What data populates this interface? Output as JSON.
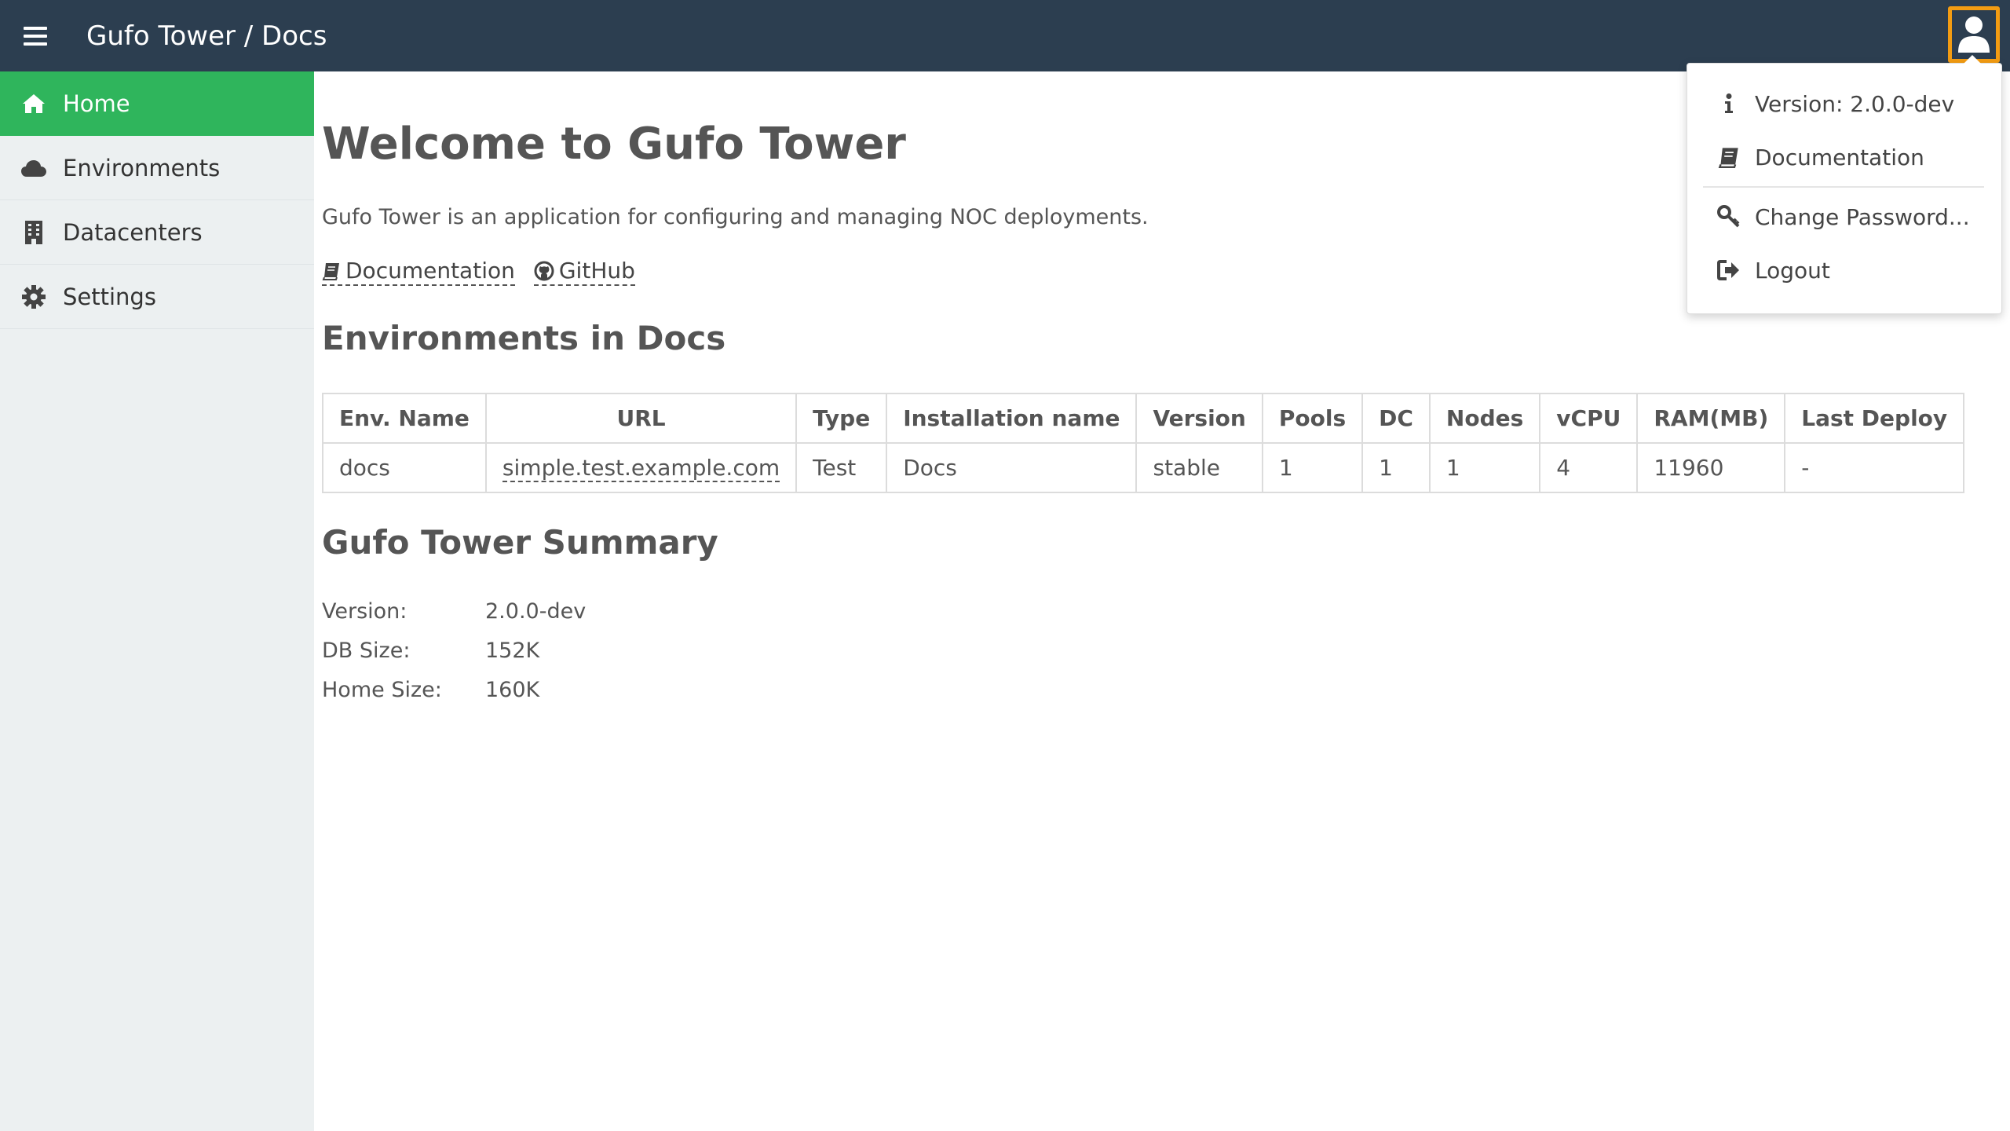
{
  "header": {
    "title": "Gufo Tower / Docs",
    "menu_icon": "hamburger-icon",
    "user_icon": "user-icon",
    "bg_color": "#2c3e50",
    "user_focus_color": "#f39c12"
  },
  "sidebar": {
    "active_color": "#2fb55c",
    "items": [
      {
        "label": "Home",
        "icon": "home-icon",
        "active": true
      },
      {
        "label": "Environments",
        "icon": "cloud-icon"
      },
      {
        "label": "Datacenters",
        "icon": "building-icon"
      },
      {
        "label": "Settings",
        "icon": "gear-icon"
      }
    ]
  },
  "main": {
    "title": "Welcome to Gufo Tower",
    "description": "Gufo Tower is an application for configuring and managing NOC deployments.",
    "links": {
      "documentation": "Documentation",
      "github": "GitHub"
    },
    "environments_heading": "Environments in Docs",
    "table": {
      "headers": [
        "Env. Name",
        "URL",
        "Type",
        "Installation name",
        "Version",
        "Pools",
        "DC",
        "Nodes",
        "vCPU",
        "RAM(MB)",
        "Last Deploy"
      ],
      "rows": [
        [
          "docs",
          "simple.test.example.com",
          "Test",
          "Docs",
          "stable",
          "1",
          "1",
          "1",
          "4",
          "11960",
          "-"
        ]
      ]
    },
    "summary_heading": "Gufo Tower Summary",
    "summary": [
      {
        "key": "Version:",
        "value": "2.0.0-dev"
      },
      {
        "key": "DB Size:",
        "value": "152K"
      },
      {
        "key": "Home Size:",
        "value": "160K"
      }
    ]
  },
  "user_menu": {
    "version": "Version: 2.0.0-dev",
    "documentation": "Documentation",
    "change_password": "Change Password...",
    "logout": "Logout"
  }
}
